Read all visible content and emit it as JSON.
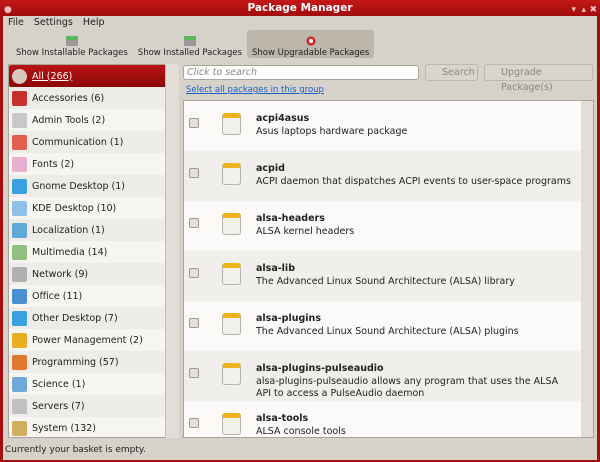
{
  "window": {
    "title": "Package Manager"
  },
  "menu": [
    "File",
    "Settings",
    "Help"
  ],
  "toolbar": [
    {
      "label": "Show Installable Packages",
      "icon": "installable-icon",
      "active": false
    },
    {
      "label": "Show Installed Packages",
      "icon": "installed-icon",
      "active": false
    },
    {
      "label": "Show Upgradable Packages",
      "icon": "upgradable-icon",
      "active": true
    }
  ],
  "categories": [
    {
      "label": "All (266)",
      "color": "#d8c8c0"
    },
    {
      "label": "Accessories (6)",
      "color": "#c83030"
    },
    {
      "label": "Admin Tools (2)",
      "color": "#c8c8c8"
    },
    {
      "label": "Communication (1)",
      "color": "#e06050"
    },
    {
      "label": "Fonts (2)",
      "color": "#e8b0d0"
    },
    {
      "label": "Gnome Desktop (1)",
      "color": "#3aa0e0"
    },
    {
      "label": "KDE Desktop (10)",
      "color": "#90c0e8"
    },
    {
      "label": "Localization (1)",
      "color": "#60a8d8"
    },
    {
      "label": "Multimedia (14)",
      "color": "#90c080"
    },
    {
      "label": "Network (9)",
      "color": "#b0b0b0"
    },
    {
      "label": "Office (11)",
      "color": "#4a90d0"
    },
    {
      "label": "Other Desktop (7)",
      "color": "#3aa0e0"
    },
    {
      "label": "Power Management (2)",
      "color": "#e8b020"
    },
    {
      "label": "Programming (57)",
      "color": "#e07830"
    },
    {
      "label": "Science (1)",
      "color": "#70a8d8"
    },
    {
      "label": "Servers (7)",
      "color": "#c0c0c0"
    },
    {
      "label": "System (132)",
      "color": "#d0b060"
    }
  ],
  "search": {
    "placeholder": "Click to search",
    "button": "Search",
    "upgrade": "Upgrade Package(s)"
  },
  "select_all": "Select all packages in this group",
  "packages": [
    {
      "name": "acpi4asus",
      "desc": "Asus laptops hardware package"
    },
    {
      "name": "acpid",
      "desc": "ACPI daemon that dispatches ACPI events to user-space programs"
    },
    {
      "name": "alsa-headers",
      "desc": "ALSA kernel headers"
    },
    {
      "name": "alsa-lib",
      "desc": "The Advanced Linux Sound Architecture (ALSA) library"
    },
    {
      "name": "alsa-plugins",
      "desc": "The Advanced Linux Sound Architecture (ALSA) plugins"
    },
    {
      "name": "alsa-plugins-pulseaudio",
      "desc": "alsa-plugins-pulseaudio allows any program that uses the ALSA API to access a PulseAudio daemon"
    },
    {
      "name": "alsa-tools",
      "desc": "ALSA console tools"
    }
  ],
  "status": "Currently your basket is empty.",
  "colors": {
    "accent": "#a50e0e"
  }
}
